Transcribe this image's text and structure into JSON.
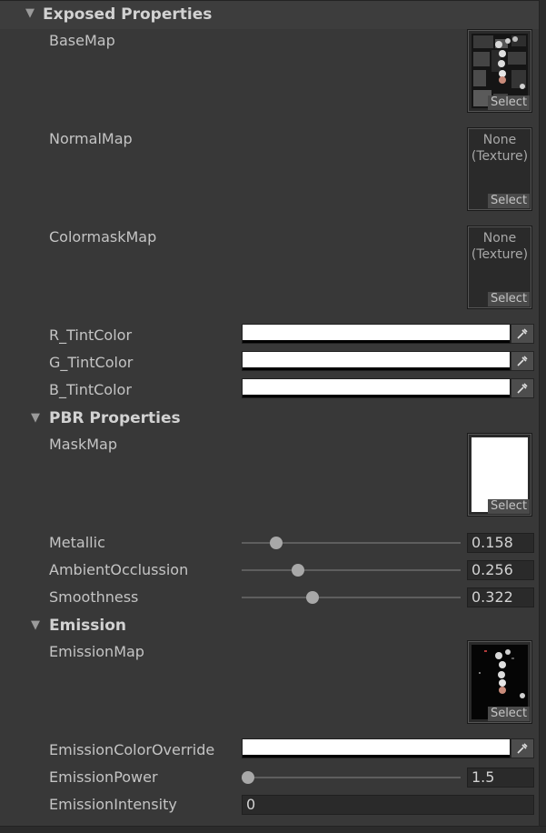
{
  "sections": {
    "exposed": {
      "title": "Exposed Properties"
    },
    "pbr": {
      "title": "PBR Properties"
    },
    "emission": {
      "title": "Emission"
    }
  },
  "props": {
    "base_map": {
      "label": "BaseMap",
      "select": "Select"
    },
    "normal_map": {
      "label": "NormalMap",
      "none": "None\n(Texture)",
      "select": "Select"
    },
    "colormask_map": {
      "label": "ColormaskMap",
      "none": "None\n(Texture)",
      "select": "Select"
    },
    "r_tint": {
      "label": "R_TintColor",
      "color": "#ffffff"
    },
    "g_tint": {
      "label": "G_TintColor",
      "color": "#ffffff"
    },
    "b_tint": {
      "label": "B_TintColor",
      "color": "#ffffff"
    },
    "mask_map": {
      "label": "MaskMap",
      "select": "Select"
    },
    "metallic": {
      "label": "Metallic",
      "value": "0.158",
      "fraction": 0.158
    },
    "ambient_occlusion": {
      "label": "AmbientOcclussion",
      "value": "0.256",
      "fraction": 0.256
    },
    "smoothness": {
      "label": "Smoothness",
      "value": "0.322",
      "fraction": 0.322
    },
    "emission_map": {
      "label": "EmissionMap",
      "select": "Select"
    },
    "emission_color_override": {
      "label": "EmissionColorOverride",
      "color": "#ffffff"
    },
    "emission_power": {
      "label": "EmissionPower",
      "value": "1.5",
      "fraction": 0.03
    },
    "emission_intensity": {
      "label": "EmissionIntensity",
      "value": "0"
    }
  }
}
